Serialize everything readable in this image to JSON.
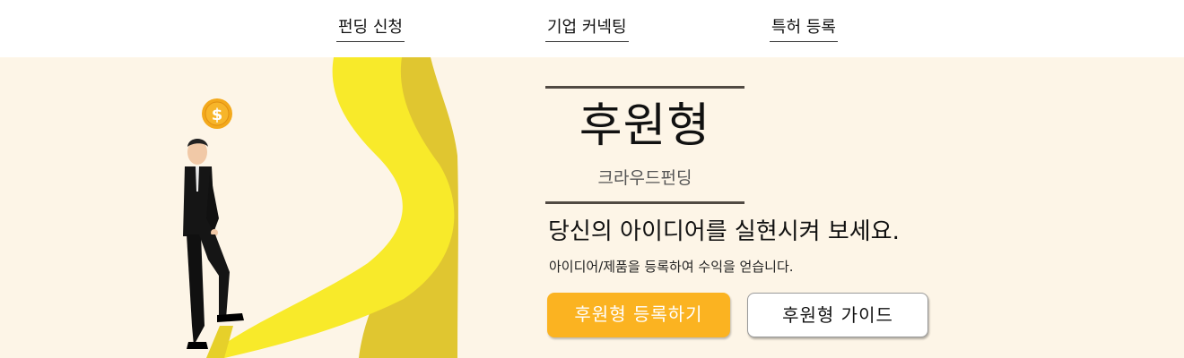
{
  "nav": {
    "items": [
      {
        "label": "펀딩 신청"
      },
      {
        "label": "기업 커넥팅"
      },
      {
        "label": "특허 등록"
      }
    ]
  },
  "hero": {
    "title": "후원형",
    "subtitle": "크라우드펀딩",
    "headline": "당신의 아이디어를 실현시켜 보세요.",
    "description": "아이디어/제품을 등록하여 수익을 얻습니다.",
    "primary_button": "후원형 등록하기",
    "secondary_button": "후원형 가이드",
    "coin_symbol": "$"
  },
  "colors": {
    "hero_background": "#fdf5e7",
    "primary_button": "#fbb321",
    "road_yellow": "#f8ea2a",
    "road_shadow": "#e0c630"
  },
  "icons": {
    "coin": "dollar-coin-icon",
    "person": "businessman-climbing-illustration"
  }
}
